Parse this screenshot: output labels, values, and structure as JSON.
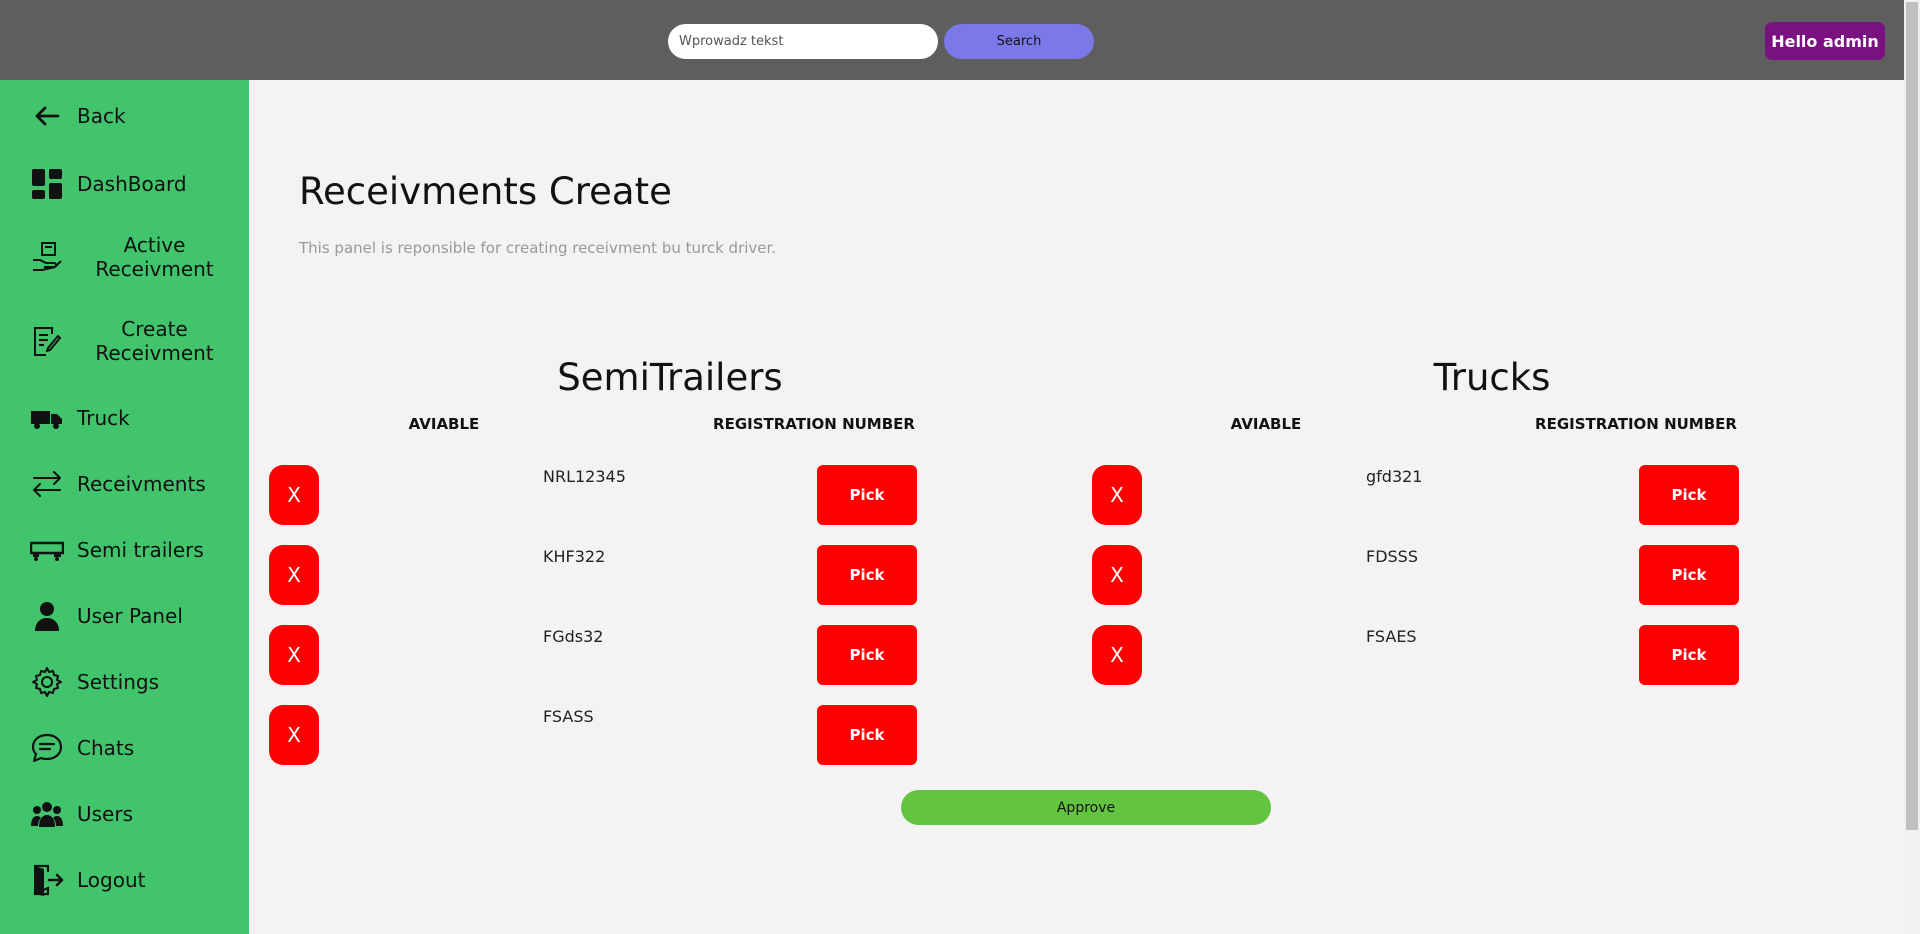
{
  "header": {
    "search_placeholder": "Wprowadz tekst",
    "search_button": "Search",
    "user_button": "Hello admin"
  },
  "sidebar": {
    "items": [
      {
        "label": "Back",
        "icon": "arrow-left-icon"
      },
      {
        "label": "DashBoard",
        "icon": "dashboard-icon"
      },
      {
        "label": "Active Receivment",
        "icon": "package-hand-icon"
      },
      {
        "label": "Create Receivment",
        "icon": "document-edit-icon"
      },
      {
        "label": "Truck",
        "icon": "truck-icon"
      },
      {
        "label": "Receivments",
        "icon": "arrows-exchange-icon"
      },
      {
        "label": "Semi trailers",
        "icon": "semi-trailer-icon"
      },
      {
        "label": "User Panel",
        "icon": "user-icon"
      },
      {
        "label": "Settings",
        "icon": "gear-icon"
      },
      {
        "label": "Chats",
        "icon": "chat-icon"
      },
      {
        "label": "Users",
        "icon": "users-group-icon"
      },
      {
        "label": "Logout",
        "icon": "logout-door-icon"
      }
    ]
  },
  "main": {
    "title": "Receivments Create",
    "description": "This panel is reponsible for creating receivment bu turck driver."
  },
  "semitrailers": {
    "title": "SemiTrailers",
    "col_available": "AVIABLE",
    "col_registration": "REGISTRATION NUMBER",
    "rows": [
      {
        "available": "X",
        "registration": "NRL12345",
        "action": "Pick"
      },
      {
        "available": "X",
        "registration": "KHF322",
        "action": "Pick"
      },
      {
        "available": "X",
        "registration": "FGds32",
        "action": "Pick"
      },
      {
        "available": "X",
        "registration": "FSASS",
        "action": "Pick"
      }
    ]
  },
  "trucks": {
    "title": "Trucks",
    "col_available": "AVIABLE",
    "col_registration": "REGISTRATION NUMBER",
    "rows": [
      {
        "available": "X",
        "registration": "gfd321",
        "action": "Pick"
      },
      {
        "available": "X",
        "registration": "FDSSS",
        "action": "Pick"
      },
      {
        "available": "X",
        "registration": "FSAES",
        "action": "Pick"
      }
    ]
  },
  "approve_button": "Approve",
  "colors": {
    "topbar": "#5e5e5e",
    "sidebar": "#41c46b",
    "search_button": "#7b79e8",
    "user_button": "#7a1180",
    "danger": "#ff0000",
    "approve": "#63c440"
  }
}
